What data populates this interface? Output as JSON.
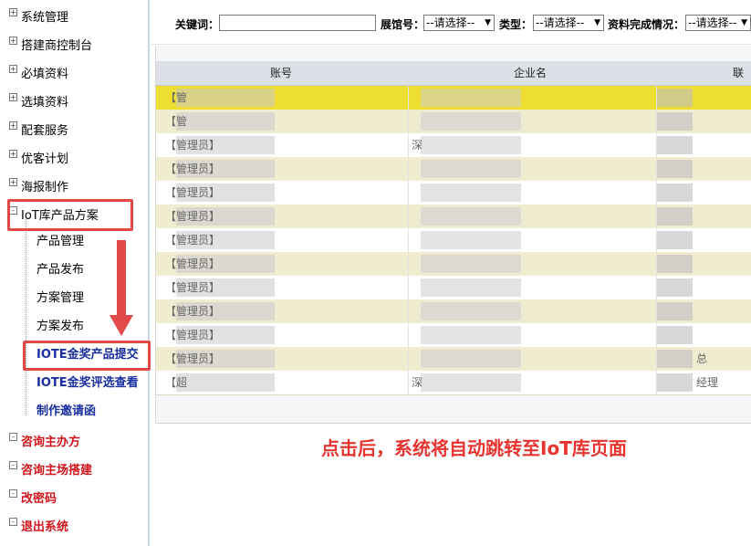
{
  "sidebar": {
    "items": [
      {
        "label": "系统管理",
        "expander": "+"
      },
      {
        "label": "搭建商控制台",
        "expander": "+"
      },
      {
        "label": "必填资料",
        "expander": "+"
      },
      {
        "label": "选填资料",
        "expander": "+"
      },
      {
        "label": "配套服务",
        "expander": "+"
      },
      {
        "label": "优客计划",
        "expander": "+"
      },
      {
        "label": "海报制作",
        "expander": "+"
      },
      {
        "label": "IoT库产品方案",
        "expander": "-"
      }
    ],
    "subitems": [
      {
        "label": "产品管理"
      },
      {
        "label": "产品发布"
      },
      {
        "label": "方案管理"
      },
      {
        "label": "方案发布"
      },
      {
        "label": "IOTE金奖产品提交"
      },
      {
        "label": "IOTE金奖评选查看"
      },
      {
        "label": "制作邀请函"
      }
    ],
    "bottom_items": [
      {
        "label": "咨询主办方",
        "expander": "-"
      },
      {
        "label": "咨询主场搭建",
        "expander": "-"
      },
      {
        "label": "改密码",
        "expander": "-"
      },
      {
        "label": "退出系统",
        "expander": "-"
      }
    ]
  },
  "search": {
    "keyword_label": "关键词：",
    "keyword_value": "",
    "hall_label": "展馆号：",
    "hall_value": "--请选择--",
    "type_label": "类型：",
    "type_value": "--请选择--",
    "completion_label": "资料完成情况：",
    "completion_value": "--请选择--"
  },
  "table": {
    "columns": [
      "账号",
      "企业名",
      "联系"
    ],
    "rows": [
      {
        "account": "【管",
        "company": "",
        "contact": ""
      },
      {
        "account": "【管",
        "company": "",
        "contact": ""
      },
      {
        "account": "【管理员】",
        "company": "深",
        "contact": ""
      },
      {
        "account": "【管理员】",
        "company": "",
        "contact": ""
      },
      {
        "account": "【管理员】",
        "company": "",
        "contact": ""
      },
      {
        "account": "【管理员】",
        "company": "",
        "contact": ""
      },
      {
        "account": "【管理员】",
        "company": "",
        "contact": ""
      },
      {
        "account": "【管理员】",
        "company": "",
        "contact": ""
      },
      {
        "account": "【管理员】",
        "company": "",
        "contact": ""
      },
      {
        "account": "【管理员】",
        "company": "",
        "contact": ""
      },
      {
        "account": "【管理员】",
        "company": "",
        "contact": ""
      },
      {
        "account": "【管理员】",
        "company": "",
        "contact": "总"
      },
      {
        "account": "【超",
        "company": "深",
        "contact": "经理"
      }
    ]
  },
  "annotation": {
    "text": "点击后，系统将自动跳转至IoT库页面",
    "color": "#e8342f"
  }
}
